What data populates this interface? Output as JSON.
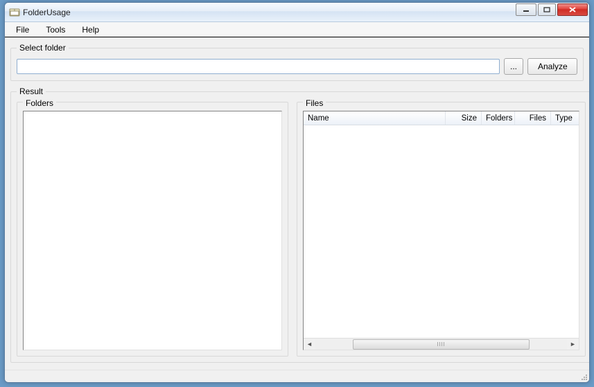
{
  "window": {
    "title": "FolderUsage"
  },
  "menu": {
    "file": "File",
    "tools": "Tools",
    "help": "Help"
  },
  "select_folder": {
    "legend": "Select folder",
    "path_value": "",
    "path_placeholder": "",
    "browse_label": "...",
    "analyze_label": "Analyze"
  },
  "result": {
    "legend": "Result",
    "folders_legend": "Folders",
    "files_legend": "Files",
    "columns": {
      "name": "Name",
      "size": "Size",
      "folders": "Folders",
      "files": "Files",
      "type": "Type"
    },
    "folders_items": [],
    "files_rows": []
  }
}
